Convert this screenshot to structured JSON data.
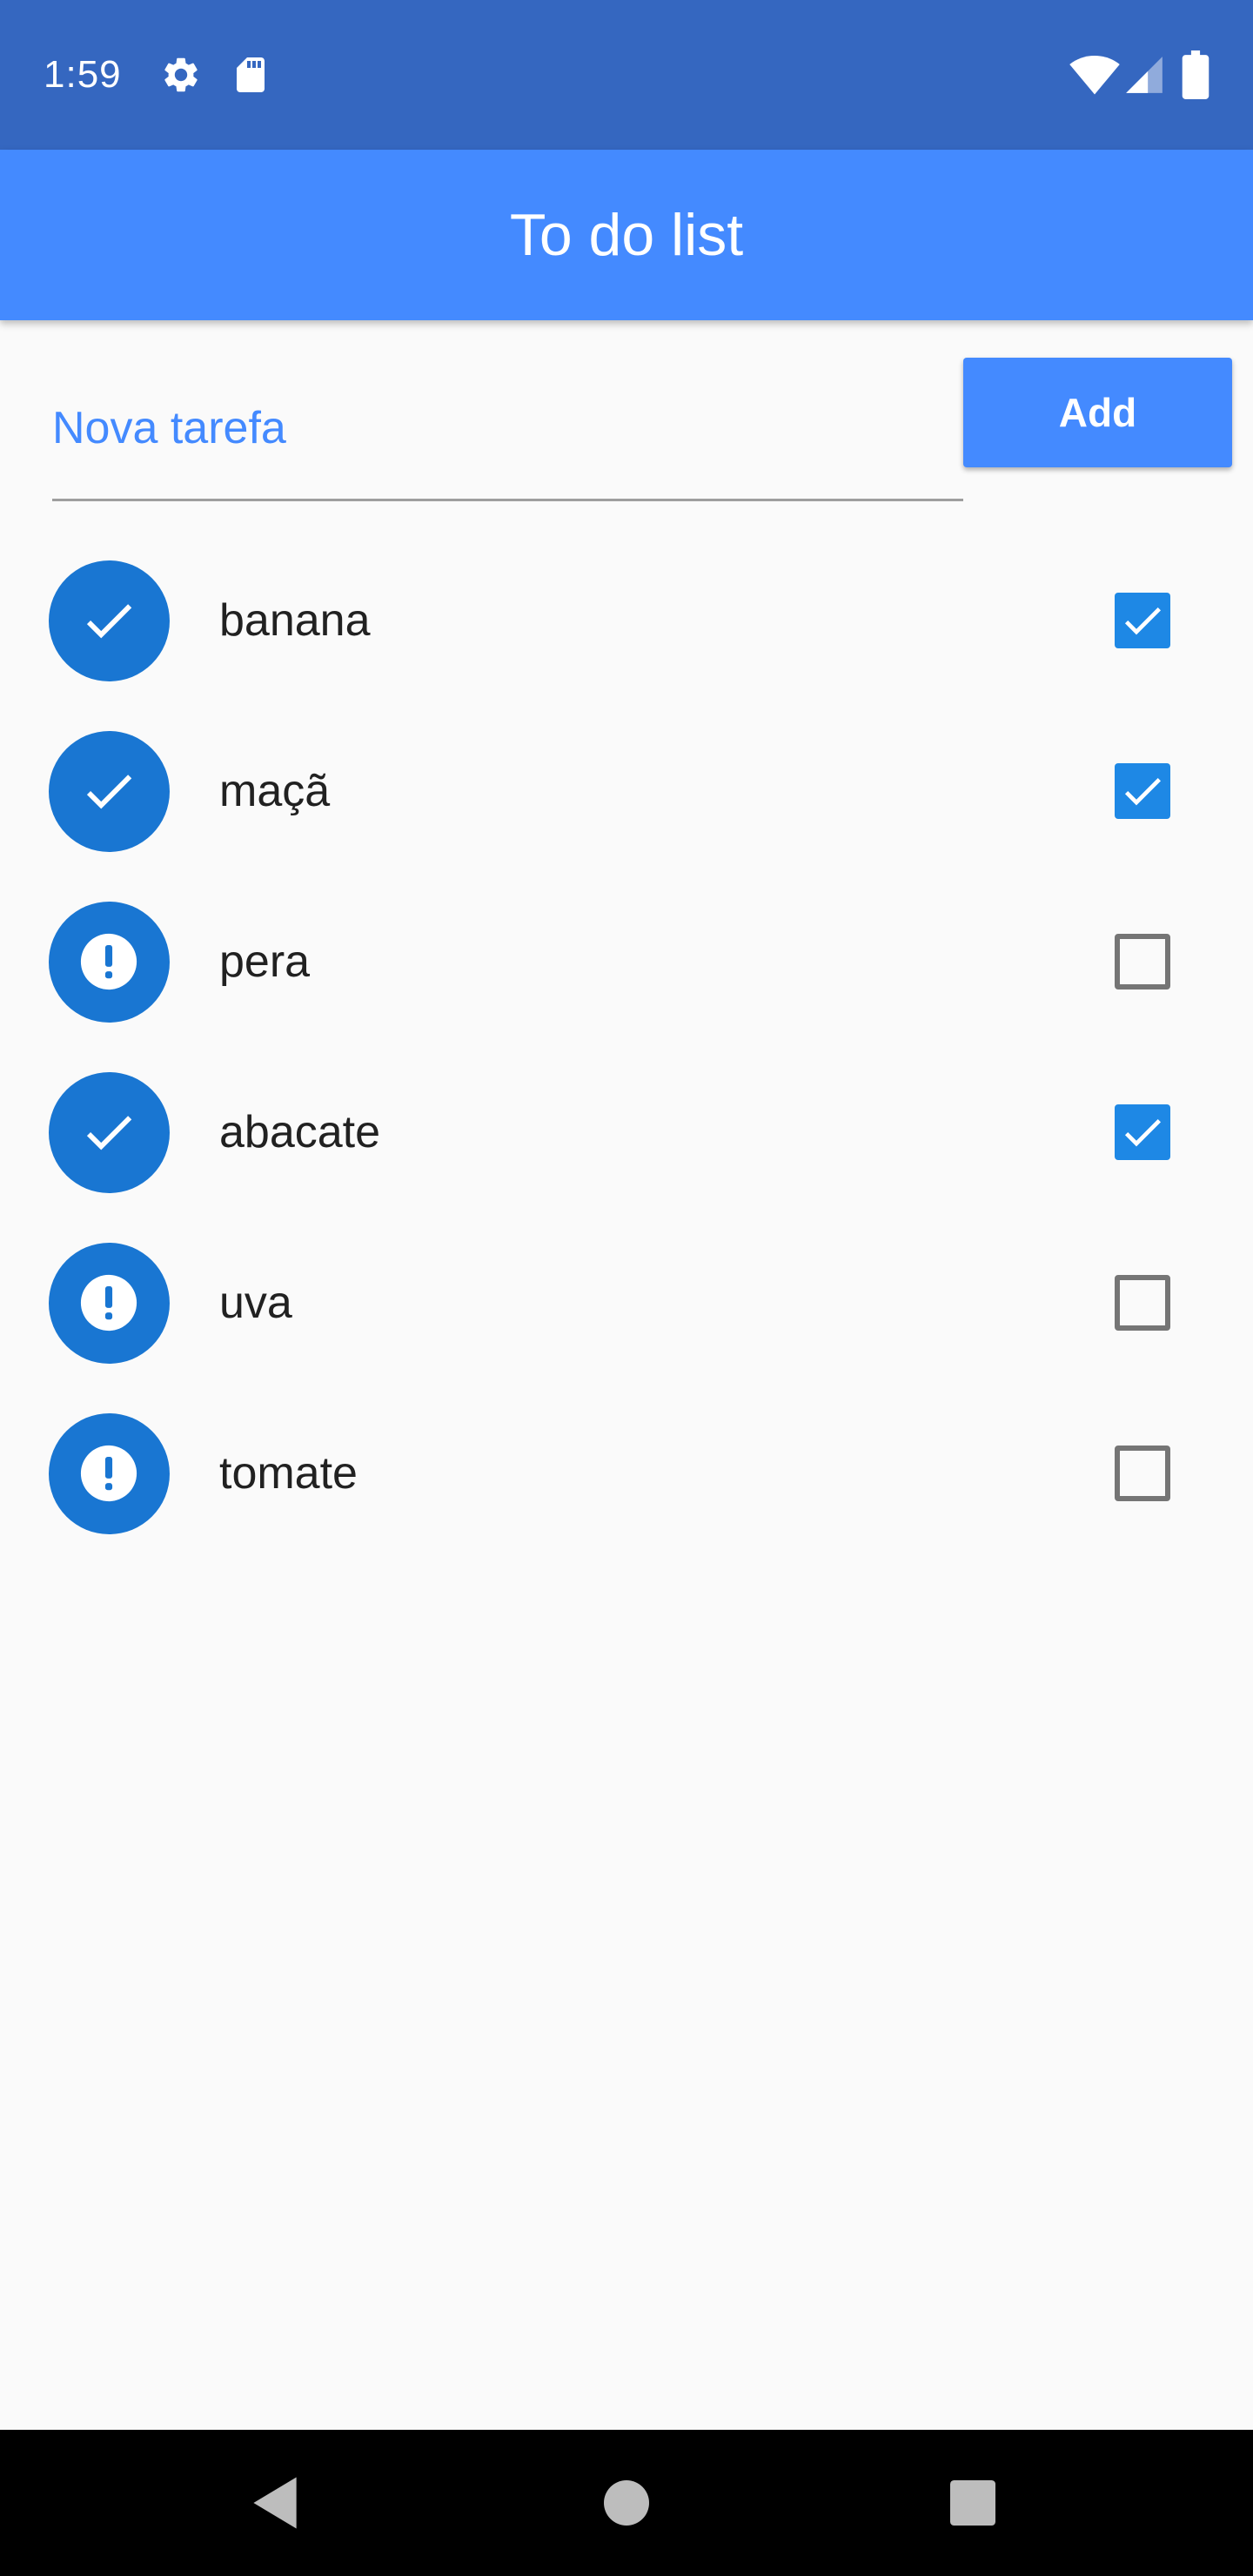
{
  "status_bar": {
    "time": "1:59",
    "icons": [
      "settings-icon",
      "sd-card-icon",
      "wifi-icon",
      "cellular-signal-icon",
      "battery-icon"
    ]
  },
  "app_bar": {
    "title": "To do list"
  },
  "input": {
    "placeholder": "Nova tarefa",
    "value": ""
  },
  "add_button": {
    "label": "Add"
  },
  "tasks": [
    {
      "label": "banana",
      "done": true,
      "status_icon": "check-icon"
    },
    {
      "label": "maçã",
      "done": true,
      "status_icon": "check-icon"
    },
    {
      "label": "pera",
      "done": false,
      "status_icon": "alert-icon"
    },
    {
      "label": "abacate",
      "done": true,
      "status_icon": "check-icon"
    },
    {
      "label": "uva",
      "done": false,
      "status_icon": "alert-icon"
    },
    {
      "label": "tomate",
      "done": false,
      "status_icon": "alert-icon"
    }
  ],
  "nav_bar": {
    "buttons": [
      "back-icon",
      "home-icon",
      "recents-icon"
    ]
  },
  "colors": {
    "status_bar": "#3567c0",
    "app_bar": "#448aff",
    "accent": "#1976d2",
    "checkbox_checked": "#1e88e5",
    "background": "#fafafa"
  }
}
